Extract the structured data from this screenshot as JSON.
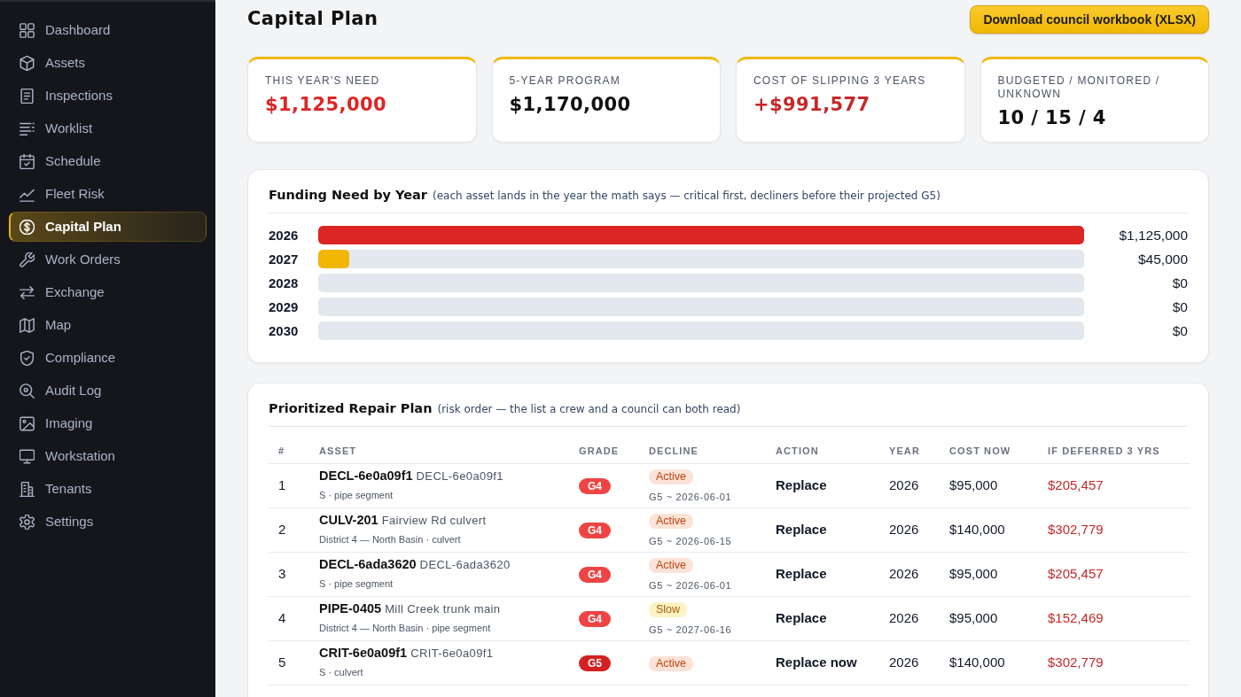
{
  "sidebar": {
    "items": [
      {
        "label": "Dashboard",
        "selected": false
      },
      {
        "label": "Assets",
        "selected": false
      },
      {
        "label": "Inspections",
        "selected": false
      },
      {
        "label": "Worklist",
        "selected": false
      },
      {
        "label": "Schedule",
        "selected": false
      },
      {
        "label": "Fleet Risk",
        "selected": false
      },
      {
        "label": "Capital Plan",
        "selected": true
      },
      {
        "label": "Work Orders",
        "selected": false
      },
      {
        "label": "Exchange",
        "selected": false
      },
      {
        "label": "Map",
        "selected": false
      },
      {
        "label": "Compliance",
        "selected": false
      },
      {
        "label": "Audit Log",
        "selected": false
      },
      {
        "label": "Imaging",
        "selected": false
      },
      {
        "label": "Workstation",
        "selected": false
      },
      {
        "label": "Tenants",
        "selected": false
      },
      {
        "label": "Settings",
        "selected": false
      }
    ]
  },
  "header": {
    "title": "Capital Plan",
    "download_button": "Download council workbook (XLSX)"
  },
  "kpis": [
    {
      "label": "THIS YEAR'S NEED",
      "value": "$1,125,000",
      "color": "#dc2626"
    },
    {
      "label": "5-YEAR PROGRAM",
      "value": "$1,170,000",
      "color": "#111111"
    },
    {
      "label": "COST OF SLIPPING 3 YEARS",
      "value": "+$991,577",
      "color": "#c62828"
    },
    {
      "label": "BUDGETED / MONITORED / UNKNOWN",
      "value": "10 / 15 / 4",
      "color": "#111111"
    }
  ],
  "funding": {
    "title": "Funding Need by Year",
    "note": "(each asset lands in the year the math says — critical first, decliners before their projected G5)",
    "years": [
      {
        "year": "2026",
        "level": 1,
        "color": "#dc2626",
        "amount": "$1,125,000"
      },
      {
        "year": "2027",
        "level": 0.04,
        "color": "#f2b705",
        "amount": "$45,000"
      },
      {
        "year": "2028",
        "amount": "$0"
      },
      {
        "year": "2029",
        "amount": "$0"
      },
      {
        "year": "2030",
        "amount": "$0"
      }
    ]
  },
  "repair_plan": {
    "title": "Prioritized Repair Plan",
    "note": "(risk order — the list a crew and a council can both read)",
    "table": {
      "columns": [
        "#",
        "ASSET",
        "GRADE",
        "DECLINE",
        "ACTION",
        "YEAR",
        "COST NOW",
        "IF DEFERRED 3 YRS"
      ],
      "rows": [
        {
          "number": "1",
          "asset_id": "DECL-6e0a09f1",
          "asset_name": "DECL-6e0a09f1",
          "location": "S · pipe segment",
          "grade": {
            "label": "G4",
            "color": "#ef4444"
          },
          "decline": {
            "label": "Active",
            "kind": "active",
            "projection": "G5 ~ 2026-06-01"
          },
          "action": "Replace",
          "year": "2026",
          "cost_now": "$95,000",
          "deferred_cost": "$205,457"
        },
        {
          "number": "2",
          "asset_id": "CULV-201",
          "asset_name": "Fairview Rd culvert",
          "location": "District 4 — North Basin · culvert",
          "grade": {
            "label": "G4",
            "color": "#ef4444"
          },
          "decline": {
            "label": "Active",
            "kind": "active",
            "projection": "G5 ~ 2026-06-15"
          },
          "action": "Replace",
          "year": "2026",
          "cost_now": "$140,000",
          "deferred_cost": "$302,779"
        },
        {
          "number": "3",
          "asset_id": "DECL-6ada3620",
          "asset_name": "DECL-6ada3620",
          "location": "S · pipe segment",
          "grade": {
            "label": "G4",
            "color": "#ef4444"
          },
          "decline": {
            "label": "Active",
            "kind": "active",
            "projection": "G5 ~ 2026-06-01"
          },
          "action": "Replace",
          "year": "2026",
          "cost_now": "$95,000",
          "deferred_cost": "$205,457"
        },
        {
          "number": "4",
          "asset_id": "PIPE-0405",
          "asset_name": "Mill Creek trunk main",
          "location": "District 4 — North Basin · pipe segment",
          "grade": {
            "label": "G4",
            "color": "#ef4444"
          },
          "decline": {
            "label": "Slow",
            "kind": "slow",
            "projection": "G5 ~ 2027-06-16"
          },
          "action": "Replace",
          "year": "2026",
          "cost_now": "$95,000",
          "deferred_cost": "$152,469"
        },
        {
          "number": "5",
          "asset_id": "CRIT-6e0a09f1",
          "asset_name": "CRIT-6e0a09f1",
          "location": "S · culvert",
          "grade": {
            "label": "G5",
            "color": "#d32020"
          },
          "decline": {
            "label": "Active",
            "kind": "active"
          },
          "action": "Replace now",
          "year": "2026",
          "cost_now": "$140,000",
          "deferred_cost": "$302,779"
        }
      ]
    }
  }
}
